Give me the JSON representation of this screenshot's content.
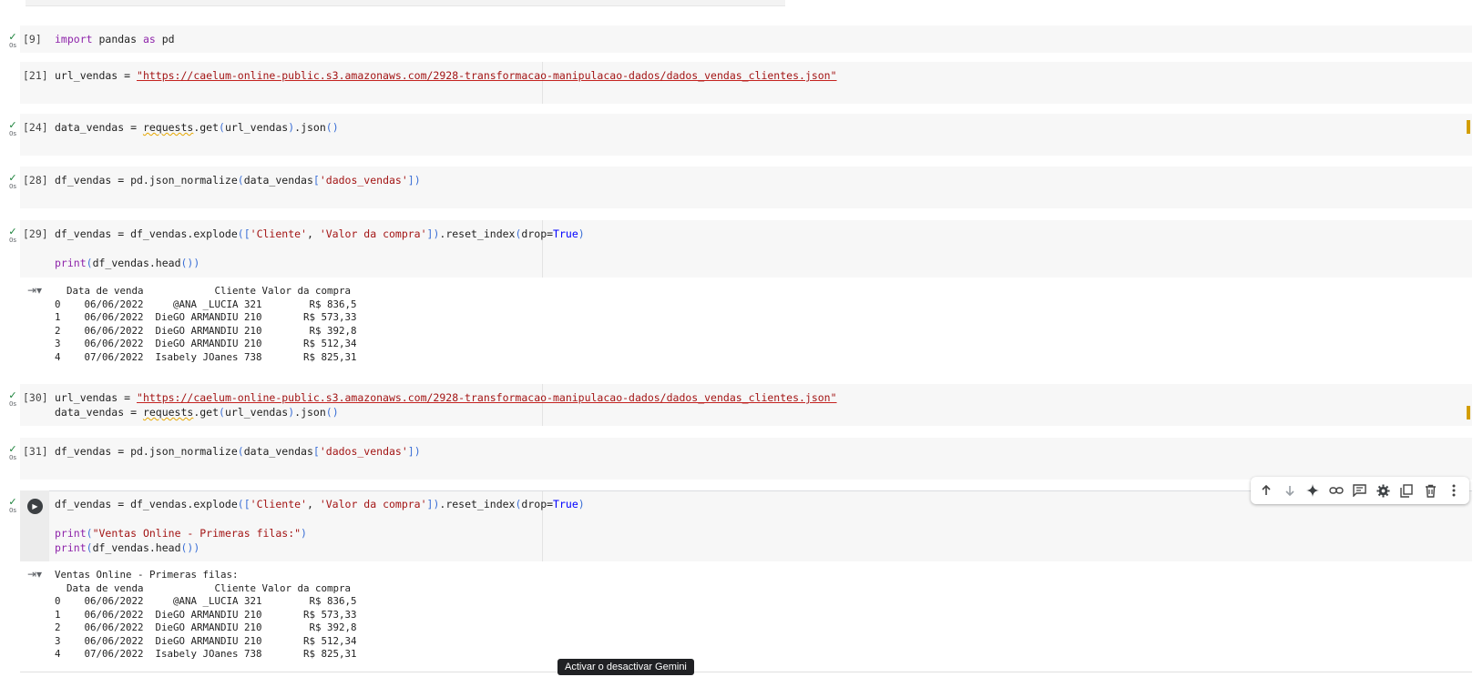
{
  "cells": [
    {
      "id": "c9",
      "exec": "[9]",
      "status": "ok",
      "time": "0s",
      "code": [
        [
          {
            "t": "import",
            "c": "kw"
          },
          {
            "t": " pandas "
          },
          {
            "t": "as",
            "c": "kw"
          },
          {
            "t": " pd"
          }
        ]
      ]
    },
    {
      "id": "c21",
      "exec": "[21]",
      "status": "",
      "time": "",
      "code": [
        [
          {
            "t": "url_vendas = "
          },
          {
            "t": "\"https://caelum-online-public.s3.amazonaws.com/2928-transformacao-manipulacao-dados/dados_vendas_clientes.json\"",
            "c": "url"
          }
        ]
      ]
    },
    {
      "id": "c24",
      "exec": "[24]",
      "status": "ok",
      "time": "0s",
      "marker": true,
      "code": [
        [
          {
            "t": "data_vendas = "
          },
          {
            "t": "requests",
            "c": "squig"
          },
          {
            "t": ".get"
          },
          {
            "t": "(",
            "c": "paren"
          },
          {
            "t": "url_vendas"
          },
          {
            "t": ")",
            "c": "paren"
          },
          {
            "t": ".json"
          },
          {
            "t": "()",
            "c": "paren"
          }
        ]
      ]
    },
    {
      "id": "c28",
      "exec": "[28]",
      "status": "ok",
      "time": "0s",
      "code": [
        [
          {
            "t": "df_vendas = pd.json_normalize"
          },
          {
            "t": "(",
            "c": "paren"
          },
          {
            "t": "data_vendas"
          },
          {
            "t": "[",
            "c": "paren"
          },
          {
            "t": "'dados_vendas'",
            "c": "str"
          },
          {
            "t": "]",
            "c": "paren"
          },
          {
            "t": ")",
            "c": "paren"
          }
        ]
      ]
    },
    {
      "id": "c29",
      "exec": "[29]",
      "status": "ok",
      "time": "0s",
      "code": [
        [
          {
            "t": "df_vendas = df_vendas.explode"
          },
          {
            "t": "([",
            "c": "paren"
          },
          {
            "t": "'Cliente'",
            "c": "str"
          },
          {
            "t": ", "
          },
          {
            "t": "'Valor da compra'",
            "c": "str"
          },
          {
            "t": "])",
            "c": "paren"
          },
          {
            "t": ".reset_index"
          },
          {
            "t": "(",
            "c": "paren"
          },
          {
            "t": "drop="
          },
          {
            "t": "True",
            "c": "bool"
          },
          {
            "t": ")",
            "c": "paren"
          }
        ],
        [],
        [
          {
            "t": "print",
            "c": "kw"
          },
          {
            "t": "(",
            "c": "paren"
          },
          {
            "t": "df_vendas.head"
          },
          {
            "t": "())",
            "c": "paren"
          }
        ]
      ]
    },
    {
      "id": "c30",
      "exec": "[30]",
      "status": "ok",
      "time": "0s",
      "marker": true,
      "code": [
        [
          {
            "t": "url_vendas = "
          },
          {
            "t": "\"https://caelum-online-public.s3.amazonaws.com/2928-transformacao-manipulacao-dados/dados_vendas_clientes.json\"",
            "c": "url"
          }
        ],
        [
          {
            "t": "data_vendas = "
          },
          {
            "t": "requests",
            "c": "squig"
          },
          {
            "t": ".get"
          },
          {
            "t": "(",
            "c": "paren"
          },
          {
            "t": "url_vendas"
          },
          {
            "t": ")",
            "c": "paren"
          },
          {
            "t": ".json"
          },
          {
            "t": "()",
            "c": "paren"
          }
        ]
      ]
    },
    {
      "id": "c31",
      "exec": "[31]",
      "status": "ok",
      "time": "0s",
      "code": [
        [
          {
            "t": "df_vendas = pd.json_normalize"
          },
          {
            "t": "(",
            "c": "paren"
          },
          {
            "t": "data_vendas"
          },
          {
            "t": "[",
            "c": "paren"
          },
          {
            "t": "'dados_vendas'",
            "c": "str"
          },
          {
            "t": "]",
            "c": "paren"
          },
          {
            "t": ")",
            "c": "paren"
          }
        ]
      ]
    },
    {
      "id": "c32",
      "exec": "",
      "status": "ok",
      "time": "0s",
      "active": true,
      "code": [
        [
          {
            "t": "df_vendas = df_vendas.explode"
          },
          {
            "t": "([",
            "c": "paren"
          },
          {
            "t": "'Cliente'",
            "c": "str"
          },
          {
            "t": ", "
          },
          {
            "t": "'Valor da compra'",
            "c": "str"
          },
          {
            "t": "])",
            "c": "paren"
          },
          {
            "t": ".reset_index"
          },
          {
            "t": "(",
            "c": "paren"
          },
          {
            "t": "drop="
          },
          {
            "t": "True",
            "c": "bool"
          },
          {
            "t": ")",
            "c": "paren"
          }
        ],
        [],
        [
          {
            "t": "print",
            "c": "kw"
          },
          {
            "t": "(",
            "c": "paren"
          },
          {
            "t": "\"Ventas Online - Primeras filas:\"",
            "c": "str"
          },
          {
            "t": ")",
            "c": "paren"
          }
        ],
        [
          {
            "t": "print",
            "c": "kw"
          },
          {
            "t": "(",
            "c": "paren"
          },
          {
            "t": "df_vendas.head"
          },
          {
            "t": "())",
            "c": "paren"
          }
        ]
      ]
    }
  ],
  "outputs": {
    "c29": "  Data de venda            Cliente Valor da compra\n0    06/06/2022     @ANA _LUCIA 321        R$ 836,5\n1    06/06/2022  DieGO ARMANDIU 210       R$ 573,33\n2    06/06/2022  DieGO ARMANDIU 210        R$ 392,8\n3    06/06/2022  DieGO ARMANDIU 210       R$ 512,34\n4    07/06/2022  Isabely JOanes 738       R$ 825,31",
    "c32": "Ventas Online - Primeras filas:\n  Data de venda            Cliente Valor da compra\n0    06/06/2022     @ANA _LUCIA 321        R$ 836,5\n1    06/06/2022  DieGO ARMANDIU 210       R$ 573,33\n2    06/06/2022  DieGO ARMANDIU 210        R$ 392,8\n3    06/06/2022  DieGO ARMANDIU 210       R$ 512,34\n4    07/06/2022  Isabely JOanes 738       R$ 825,31"
  },
  "toolbar": {
    "icons": [
      "arrow-up-icon",
      "arrow-down-icon",
      "gemini-sparkle-icon",
      "link-icon",
      "comment-icon",
      "gear-icon",
      "mirror-cell-icon",
      "trash-icon",
      "more-vert-icon"
    ]
  },
  "tooltip": {
    "text": "Activar o desactivar Gemini"
  },
  "run_button": {
    "icon": "play-icon"
  },
  "status_check": "✓",
  "output_icon": "output-toggle-icon"
}
